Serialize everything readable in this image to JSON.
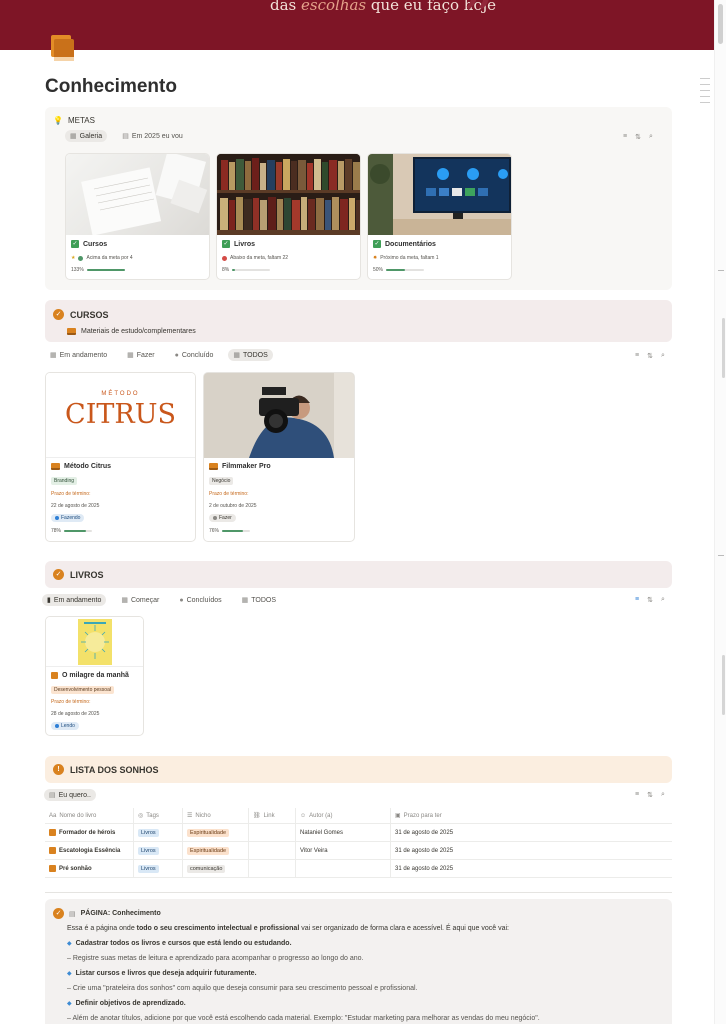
{
  "banner": {
    "quote_pre": "das ",
    "quote_em": "escolhas",
    "quote_post": " que eu faço hoje",
    "mark": "”"
  },
  "page": {
    "title": "Conhecimento"
  },
  "metas": {
    "label": "METAS",
    "tabs": [
      {
        "label": "Galeria"
      },
      {
        "label": "Em 2025 eu vou"
      }
    ],
    "cards": [
      {
        "title": "Cursos",
        "note": "Acima da meta por 4",
        "progress_label": "133%",
        "progress": 1.0
      },
      {
        "title": "Livros",
        "note": "Abaixo da meta, faltam 22",
        "progress_label": "8%",
        "progress": 0.08
      },
      {
        "title": "Documentários",
        "note": "Próximo da meta, faltam 1",
        "progress_label": "50%",
        "progress": 0.5
      }
    ]
  },
  "cursos": {
    "title": "CURSOS",
    "subtitle": "Materiais de estudo/complementares",
    "tabs": [
      {
        "label": "Em andamento"
      },
      {
        "label": "Fazer"
      },
      {
        "label": "Concluído"
      },
      {
        "label": "TODOS"
      }
    ],
    "cards": [
      {
        "cover_small": "MÉTODO",
        "cover_big": "CITRUS",
        "title": "Método Citrus",
        "tag": "Branding",
        "deadline_label": "Prazo de término:",
        "date": "22 de agosto de 2025",
        "status": "Fazendo",
        "progress_label": "78%",
        "progress": 0.78
      },
      {
        "title": "Filmmaker Pro",
        "tag": "Negócio",
        "deadline_label": "Prazo de término:",
        "date": "2 de outubro de 2025",
        "status": "Fazer",
        "progress_label": "76%",
        "progress": 0.76
      }
    ]
  },
  "livros": {
    "title": "LIVROS",
    "tabs": [
      {
        "label": "Em andamento"
      },
      {
        "label": "Começar"
      },
      {
        "label": "Concluídos"
      },
      {
        "label": "TODOS"
      }
    ],
    "cards": [
      {
        "title": "O milagre da manhã",
        "tag": "Desenvolvimento pessoal",
        "deadline_label": "Prazo de término:",
        "date": "28 de agosto de 2025",
        "status": "Lendo"
      }
    ]
  },
  "sonhos": {
    "title": "LISTA DOS SONHOS",
    "view_label": "Eu quero..",
    "columns": [
      "Nome do livro",
      "Tags",
      "Nicho",
      "Link",
      "Autor (a)",
      "Prazo para ter"
    ],
    "rows": [
      {
        "name": "Formador de hérois",
        "tag": "Livros",
        "niche": "Espiritualidade",
        "link": "",
        "author": "Nataniel Gomes",
        "deadline": "31 de agosto de 2025"
      },
      {
        "name": "Escatologia Essência",
        "tag": "Livros",
        "niche": "Espiritualidade",
        "link": "",
        "author": "Vitor Veira",
        "deadline": "31 de agosto de 2025"
      },
      {
        "name": "Pré sonhão",
        "tag": "Livros",
        "niche": "comunicação",
        "link": "",
        "author": "",
        "deadline": "31 de agosto de 2025"
      }
    ]
  },
  "info": {
    "heading": "PÁGINA: Conhecimento",
    "intro_pre": "Essa é a página onde ",
    "intro_b1": "todo o seu crescimento intelectual e profissional",
    "intro_post": " vai ser organizado de forma clara e acessível. É aqui que você vai:",
    "item1": "Cadastrar todos os livros e cursos que está lendo ou estudando.",
    "line2": "– Registre suas metas de leitura e aprendizado para acompanhar o progresso ao longo do ano.",
    "item2": "Listar cursos e livros que deseja adquirir futuramente.",
    "line3": "– Crie uma \"prateleira dos sonhos\" com aquilo que deseja consumir para seu crescimento pessoal e profissional.",
    "item3": "Definir objetivos de aprendizado.",
    "line4": "– Além de anotar títulos, adicione por que você está escolhendo cada material. Exemplo: \"Estudar marketing para melhorar as vendas do meu negócio\"."
  },
  "colors": {
    "banner": "#7e1526",
    "accent": "#d9821f",
    "check": "#3f9e57",
    "progress": "#4f9768"
  }
}
